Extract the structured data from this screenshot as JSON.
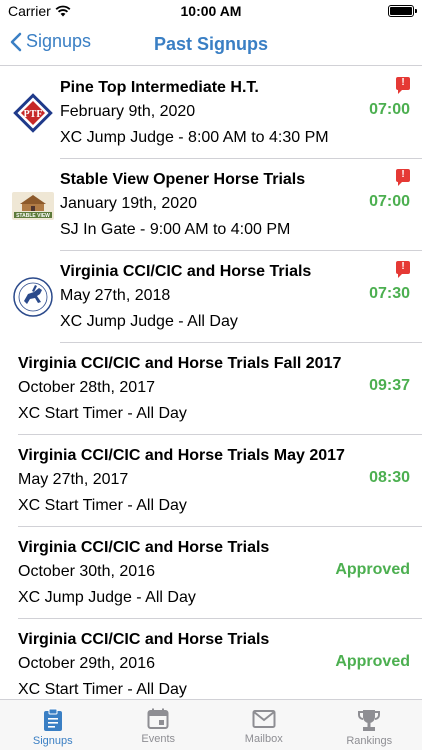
{
  "status_bar": {
    "carrier": "Carrier",
    "time": "10:00 AM"
  },
  "nav": {
    "back_label": "Signups",
    "title": "Past Signups"
  },
  "signups": [
    {
      "title": "Pine Top Intermediate H.T.",
      "date": "February 9th, 2020",
      "role": "XC Jump Judge - 8:00 AM to 4:30 PM",
      "status": "07:00",
      "flagged": true,
      "logo": "ptf-logo",
      "logo_text": "PTF"
    },
    {
      "title": "Stable View Opener Horse Trials",
      "date": "January 19th, 2020",
      "role": "SJ In Gate - 9:00 AM to 4:00 PM",
      "status": "07:00",
      "flagged": true,
      "logo": "stable-view-logo",
      "logo_text": "STABLE VIEW"
    },
    {
      "title": "Virginia CCI/CIC and Horse Trials",
      "date": "May 27th, 2018",
      "role": "XC Jump Judge - All Day",
      "status": "07:30",
      "flagged": true,
      "logo": "virginia-horse-trials-logo"
    },
    {
      "title": "Virginia CCI/CIC and Horse Trials Fall 2017",
      "date": "October 28th, 2017",
      "role": "XC Start Timer - All Day",
      "status": "09:37",
      "flagged": false
    },
    {
      "title": "Virginia CCI/CIC and Horse Trials May 2017",
      "date": "May 27th, 2017",
      "role": "XC Start Timer - All Day",
      "status": "08:30",
      "flagged": false
    },
    {
      "title": "Virginia CCI/CIC and Horse Trials",
      "date": "October 30th, 2016",
      "role": "XC Jump Judge - All Day",
      "status": "Approved",
      "flagged": false
    },
    {
      "title": "Virginia CCI/CIC and Horse Trials",
      "date": "October 29th, 2016",
      "role": "XC Start Timer - All Day",
      "status": "Approved",
      "flagged": false
    }
  ],
  "tabs": [
    {
      "label": "Signups",
      "icon": "clipboard-icon",
      "active": true
    },
    {
      "label": "Events",
      "icon": "calendar-icon",
      "active": false
    },
    {
      "label": "Mailbox",
      "icon": "mail-icon",
      "active": false
    },
    {
      "label": "Rankings",
      "icon": "trophy-icon",
      "active": false
    }
  ],
  "colors": {
    "accent": "#3a7fc4",
    "status_green": "#4caf50",
    "flag_red": "#e53935",
    "inactive": "#8e8e93"
  }
}
